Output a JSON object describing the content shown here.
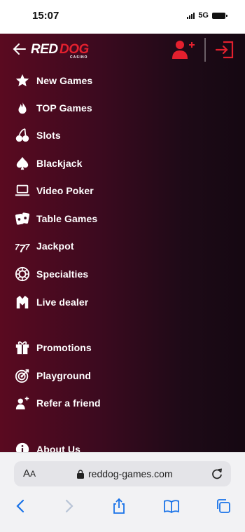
{
  "status": {
    "time": "15:07",
    "network": "5G"
  },
  "header": {
    "logo_text": "REDDOG",
    "logo_sub": "CASINO"
  },
  "menu": {
    "items": [
      {
        "label": "New Games",
        "icon": "star-icon"
      },
      {
        "label": "TOP Games",
        "icon": "fire-icon"
      },
      {
        "label": "Slots",
        "icon": "cherry-icon"
      },
      {
        "label": "Blackjack",
        "icon": "spade-icon"
      },
      {
        "label": "Video Poker",
        "icon": "laptop-icon"
      },
      {
        "label": "Table Games",
        "icon": "cards-icon"
      },
      {
        "label": "Jackpot",
        "icon": "seven-icon"
      },
      {
        "label": "Specialties",
        "icon": "chip-icon"
      },
      {
        "label": "Live dealer",
        "icon": "dealer-icon"
      },
      {
        "label": "Promotions",
        "icon": "gift-icon"
      },
      {
        "label": "Playground",
        "icon": "target-icon"
      },
      {
        "label": "Refer a friend",
        "icon": "refer-icon"
      },
      {
        "label": "About Us",
        "icon": "info-icon"
      }
    ]
  },
  "browser": {
    "aa_label": "A",
    "aa_small": "A",
    "url": "reddog-games.com"
  },
  "colors": {
    "brand_red": "#e3202e",
    "menu_text": "#ffffff",
    "browser_blue": "#1a73e8"
  }
}
